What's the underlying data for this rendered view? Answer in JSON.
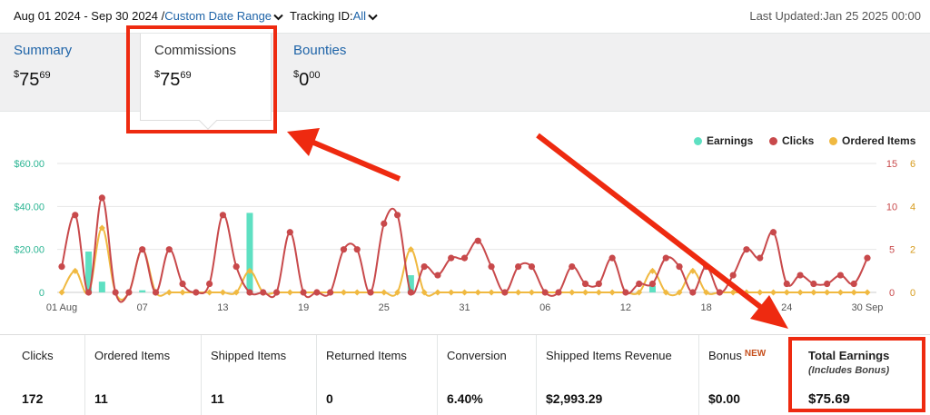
{
  "header": {
    "date_range": "Aug 01 2024 - Sep 30 2024 /",
    "date_link": "Custom Date Range",
    "tracking_label": "Tracking ID:",
    "tracking_value": "All",
    "last_updated": "Last Updated:Jan 25 2025 00:00"
  },
  "summary_tabs": [
    {
      "label": "Summary",
      "currency": "$",
      "dollars": "75",
      "cents": "69"
    },
    {
      "label": "Commissions",
      "currency": "$",
      "dollars": "75",
      "cents": "69"
    },
    {
      "label": "Bounties",
      "currency": "$",
      "dollars": "0",
      "cents": "00"
    }
  ],
  "legend": {
    "earnings": "Earnings",
    "clicks": "Clicks",
    "ordered": "Ordered Items"
  },
  "colors": {
    "earnings": "#5ee0c2",
    "clicks": "#c8494b",
    "ordered": "#f0b941",
    "link": "#1f64a8",
    "annotation": "#ee2a10"
  },
  "chart_data": {
    "type": "line",
    "x_ticks": [
      "01 Aug",
      "07",
      "13",
      "19",
      "25",
      "31",
      "06",
      "12",
      "18",
      "24",
      "30 Sep"
    ],
    "x_tick_index": [
      0,
      6,
      12,
      18,
      24,
      30,
      36,
      42,
      48,
      54,
      60
    ],
    "y_left_ticks": [
      "$60.00",
      "$40.00",
      "$20.00",
      "0"
    ],
    "y_left_range": [
      0,
      60
    ],
    "y_mid_ticks": [
      "15",
      "10",
      "5",
      "0"
    ],
    "y_mid_range": [
      0,
      15
    ],
    "y_right_ticks": [
      "6",
      "4",
      "2",
      "0"
    ],
    "y_right_range": [
      0,
      6
    ],
    "series": [
      {
        "name": "Earnings",
        "axis": "left",
        "kind": "bar",
        "values": [
          0,
          0,
          19,
          5,
          0,
          0,
          1,
          0,
          0,
          0,
          0,
          0,
          0,
          0,
          37,
          0,
          0,
          0,
          0,
          0,
          0,
          0,
          0,
          0,
          0,
          0,
          8,
          0,
          0,
          0,
          0,
          0,
          0,
          0,
          0,
          0,
          0,
          0,
          0,
          0,
          0,
          0,
          0,
          0,
          3,
          0,
          0,
          0,
          0,
          0,
          0,
          0,
          0,
          0,
          0,
          0,
          0,
          0,
          0,
          0,
          0
        ]
      },
      {
        "name": "Clicks",
        "axis": "mid",
        "kind": "line",
        "values": [
          3,
          9,
          0,
          11,
          0,
          0,
          5,
          0,
          5,
          1,
          0,
          1,
          9,
          3,
          0,
          0,
          0,
          7,
          0,
          0,
          0,
          5,
          5,
          0,
          8,
          9,
          0,
          3,
          2,
          4,
          4,
          6,
          3,
          0,
          3,
          3,
          0,
          0,
          3,
          1,
          1,
          4,
          0,
          1,
          1,
          4,
          3,
          0,
          3,
          0,
          2,
          5,
          4,
          7,
          1,
          2,
          1,
          1,
          2,
          1,
          4
        ]
      },
      {
        "name": "Ordered Items",
        "axis": "right",
        "kind": "line",
        "values": [
          0,
          1,
          0,
          3,
          0,
          0,
          2,
          0,
          0,
          0,
          0,
          0,
          0,
          0,
          1,
          0,
          0,
          0,
          0,
          0,
          0,
          0,
          0,
          0,
          0,
          0,
          2,
          0,
          0,
          0,
          0,
          0,
          0,
          0,
          0,
          0,
          0,
          0,
          0,
          0,
          0,
          0,
          0,
          0,
          1,
          0,
          0,
          1,
          0,
          0,
          0,
          0,
          0,
          0,
          0,
          0,
          0,
          0,
          0,
          0,
          0
        ]
      }
    ]
  },
  "stats": [
    {
      "label": "Clicks",
      "value": "172"
    },
    {
      "label": "Ordered Items",
      "value": "11"
    },
    {
      "label": "Shipped Items",
      "value": "11"
    },
    {
      "label": "Returned Items",
      "value": "0"
    },
    {
      "label": "Conversion",
      "value": "6.40%"
    },
    {
      "label": "Shipped Items Revenue",
      "value": "$2,993.29"
    },
    {
      "label": "Bonus",
      "badge": "NEW",
      "value": "$0.00"
    },
    {
      "label": "Total Earnings",
      "sub": "(Includes Bonus)",
      "value": "$75.69"
    }
  ]
}
